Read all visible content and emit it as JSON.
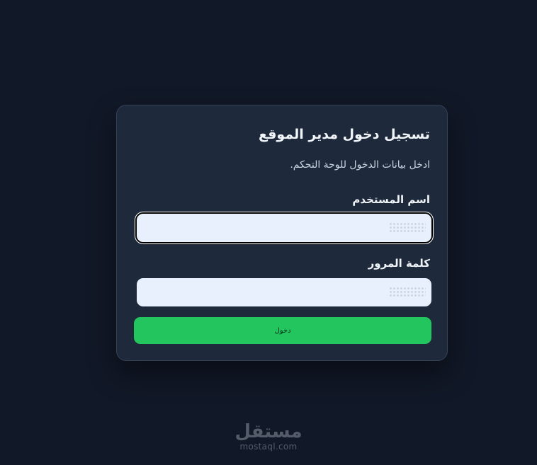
{
  "login_card": {
    "title": "تسجيل دخول مدير الموقع",
    "subtitle": "ادخل بيانات الدخول للوحة التحكم.",
    "username": {
      "label": "اسم المستخدم",
      "value": "",
      "placeholder": "",
      "focused": true
    },
    "password": {
      "label": "كلمة المرور",
      "value": "",
      "placeholder": ""
    },
    "submit_label": "دخول"
  },
  "watermark": {
    "main": "مستقل",
    "sub": "mostaql.com"
  },
  "colors": {
    "background": "#111827",
    "card": "#1e293b",
    "input": "#e8f0fe",
    "button": "#22c55e"
  }
}
